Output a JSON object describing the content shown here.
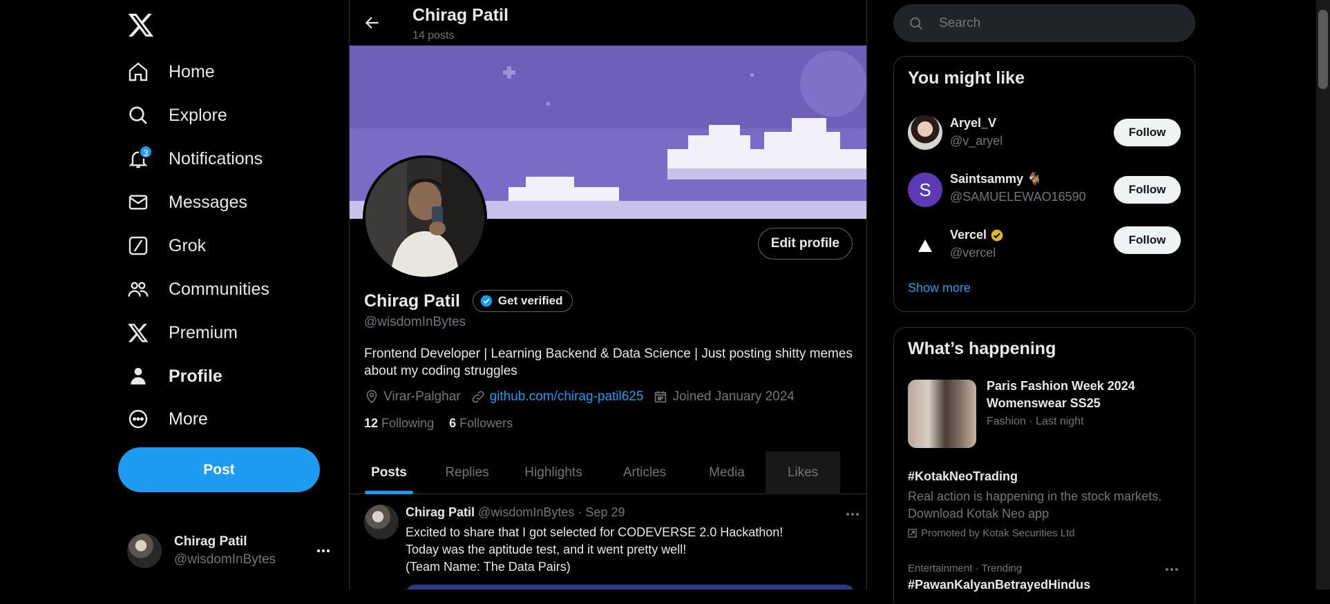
{
  "nav": {
    "items": [
      {
        "label": "Home",
        "icon": "home-icon"
      },
      {
        "label": "Explore",
        "icon": "search-icon"
      },
      {
        "label": "Notifications",
        "icon": "bell-icon",
        "badge": "3"
      },
      {
        "label": "Messages",
        "icon": "mail-icon"
      },
      {
        "label": "Grok",
        "icon": "grok-icon"
      },
      {
        "label": "Communities",
        "icon": "people-icon"
      },
      {
        "label": "Premium",
        "icon": "x-logo-icon"
      },
      {
        "label": "Profile",
        "icon": "person-icon"
      },
      {
        "label": "More",
        "icon": "more-circle-icon"
      }
    ],
    "post_label": "Post",
    "account": {
      "name": "Chirag Patil",
      "handle": "@wisdomInBytes"
    }
  },
  "header": {
    "title": "Chirag Patil",
    "subtitle": "14 posts"
  },
  "profile": {
    "edit_label": "Edit profile",
    "name": "Chirag Patil",
    "verify_label": "Get verified",
    "handle": "@wisdomInBytes",
    "bio": "Frontend Developer | Learning Backend & Data Science | Just posting shitty memes about my coding struggles",
    "location": "Virar-Palghar",
    "website": "github.com/chirag-patil625",
    "joined": "Joined January 2024",
    "following_count": "12",
    "following_label": "Following",
    "followers_count": "6",
    "followers_label": "Followers"
  },
  "tabs": [
    "Posts",
    "Replies",
    "Highlights",
    "Articles",
    "Media",
    "Likes"
  ],
  "post": {
    "name": "Chirag Patil",
    "handle": "@wisdomInBytes",
    "dot": "·",
    "date": "Sep 29",
    "lines": [
      "Excited to share that I got selected for CODEVERSE 2.0 Hackathon!",
      "Today was the aptitude test, and it went pretty well!",
      "(Team Name: The Data Pairs)"
    ]
  },
  "search": {
    "placeholder": "Search"
  },
  "suggestions": {
    "title": "You might like",
    "follow_label": "Follow",
    "users": [
      {
        "name": "Aryel_V",
        "handle": "@v_aryel"
      },
      {
        "name": "Saintsammy 🐐",
        "handle": "@SAMUELEWAO16590",
        "initial": "S"
      },
      {
        "name": "Vercel",
        "handle": "@vercel"
      }
    ],
    "show_more": "Show more"
  },
  "trends": {
    "title": "What’s happening",
    "items": [
      {
        "title": "Paris Fashion Week 2024 Womenswear SS25",
        "meta": "Fashion · Last night"
      },
      {
        "title": "#KotakNeoTrading",
        "desc": "Real action is happening in the stock markets. Download Kotak Neo app",
        "promo": "Promoted by Kotak Securities Ltd"
      },
      {
        "category": "Entertainment · Trending",
        "title": "#PawanKalyanBetrayedHindus"
      }
    ]
  },
  "colors": {
    "accent": "#1d9bf0",
    "banner": "#6f5fb8",
    "verified_gold": "#e2b719"
  }
}
